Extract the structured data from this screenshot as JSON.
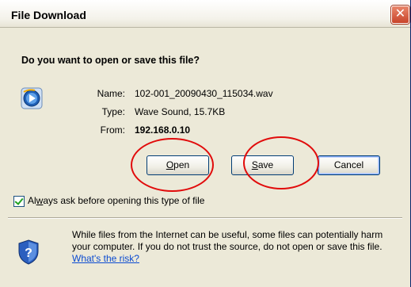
{
  "window": {
    "title": "File Download",
    "close_glyph": "✕"
  },
  "prompt": {
    "question": "Do you want to open or save this file?"
  },
  "file": {
    "icon": "windows-media-player-icon",
    "name_label": "Name:",
    "name_value": "102-001_20090430_115034.wav",
    "type_label": "Type:",
    "type_value": "Wave Sound, 15.7KB",
    "from_label": "From:",
    "from_value": "192.168.0.10"
  },
  "buttons": {
    "open": {
      "hotkey": "O",
      "rest": "pen"
    },
    "save": {
      "hotkey": "S",
      "rest": "ave"
    },
    "cancel": "Cancel"
  },
  "checkbox": {
    "checked": true,
    "prefix": "Al",
    "hotkey": "w",
    "rest": "ays ask before opening this type of file"
  },
  "warning": {
    "icon": "shield-question-icon",
    "text": "While files from the Internet can be useful, some files can potentially harm your computer. If you do not trust the source, do not open or save this file.",
    "link": "What's the risk?"
  },
  "annotations": {
    "color": "#e10b0b"
  }
}
